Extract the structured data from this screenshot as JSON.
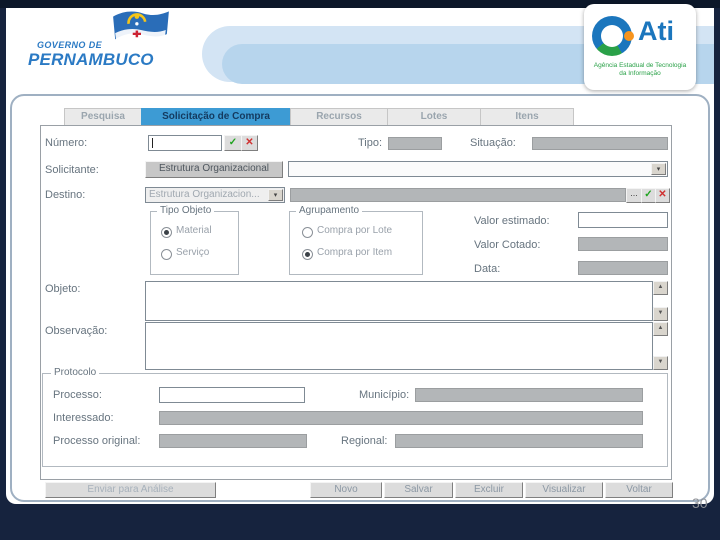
{
  "slide": {
    "page_number": "30"
  },
  "header": {
    "government": {
      "line1": "GOVERNO DE",
      "line2": "PERNAMBUCO"
    },
    "ati": {
      "name": "Ati",
      "subtitle": "Agência Estadual de Tecnologia da Informação"
    }
  },
  "window": {
    "tabs": [
      {
        "label": "Pesquisa"
      },
      {
        "label": "Solicitação de Compra"
      },
      {
        "label": "Recursos"
      },
      {
        "label": "Lotes"
      },
      {
        "label": "Itens"
      }
    ],
    "active_tab": "Solicitação de Compra",
    "fields": {
      "numero_label": "Número:",
      "tipo_label": "Tipo:",
      "situacao_label": "Situação:",
      "solicitante_label": "Solicitante:",
      "solicitante_value": "Estrutura Organizacional",
      "destino_label": "Destino:",
      "destino_value": "Estrutura Organizacion...",
      "valor_estimado_label": "Valor estimado:",
      "valor_cotado_label": "Valor Cotado:",
      "data_label": "Data:",
      "objeto_label": "Objeto:",
      "observacao_label": "Observação:"
    },
    "groups": {
      "tipo_objeto": {
        "title": "Tipo Objeto",
        "options": [
          {
            "label": "Material",
            "selected": true
          },
          {
            "label": "Serviço",
            "selected": false
          }
        ]
      },
      "agrupamento": {
        "title": "Agrupamento",
        "options": [
          {
            "label": "Compra por Lote",
            "selected": false
          },
          {
            "label": "Compra por Item",
            "selected": true
          }
        ]
      },
      "protocolo": {
        "title": "Protocolo",
        "processo_label": "Processo:",
        "municipio_label": "Município:",
        "interessado_label": "Interessado:",
        "processo_original_label": "Processo original:",
        "regional_label": "Regional:"
      }
    },
    "buttons": [
      {
        "label": "Enviar para Análise",
        "enabled": false
      },
      {
        "label": "Novo",
        "enabled": true
      },
      {
        "label": "Salvar",
        "enabled": true
      },
      {
        "label": "Excluir",
        "enabled": true
      },
      {
        "label": "Visualizar",
        "enabled": true
      },
      {
        "label": "Voltar",
        "enabled": true
      }
    ],
    "icons": {
      "confirm": "✓",
      "cancel": "✕",
      "dropdown": "▾",
      "ellipsis": "...",
      "scroll_up": "▲",
      "scroll_down": "▼"
    }
  },
  "colors": {
    "navy_background": "#16233e",
    "active_tab_blue": "#3d9bd4",
    "header_band_blue": "#b7d5ed",
    "ati_blue": "#1b76bd",
    "ati_green": "#2aa148",
    "ati_orange": "#f7941e",
    "gov_blue": "#2b7ac4",
    "disabled_field_gray": "#b3b6b8"
  }
}
